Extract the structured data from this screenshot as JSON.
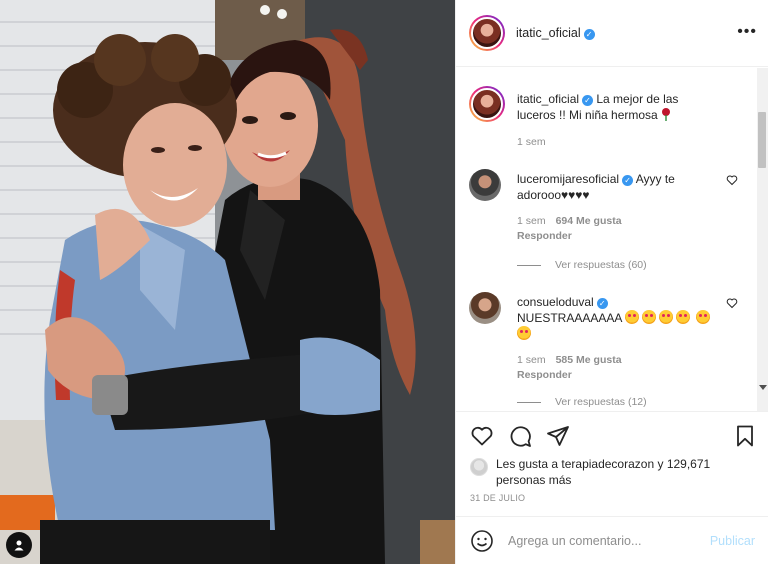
{
  "post": {
    "author": "itatic_oficial",
    "more_label": "•••",
    "photo_alt_icon": "user-tag-icon"
  },
  "caption": {
    "username": "itatic_oficial",
    "text": "La mejor de las luceros !! Mi niña hermosa",
    "time": "1 sem"
  },
  "comments": [
    {
      "username": "luceromijaresoficial",
      "text": "Ayyy te adorooo♥♥♥♥",
      "time": "1 sem",
      "likes": "694 Me gusta",
      "reply": "Responder",
      "view_replies": "Ver respuestas (60)"
    },
    {
      "username": "consueloduval",
      "text": "NUESTRAAAAAAA",
      "time": "1 sem",
      "likes": "585 Me gusta",
      "reply": "Responder",
      "view_replies": "Ver respuestas (12)"
    }
  ],
  "likes": {
    "prefix": "Les gusta a",
    "user": "terapiadecorazon",
    "suffix": "y",
    "others": "129,671 personas más"
  },
  "date": "31 DE JULIO",
  "add_comment": {
    "placeholder": "Agrega un comentario...",
    "publish": "Publicar"
  },
  "colors": {
    "verified": "#3897f0",
    "publish_disabled": "#b2dffc",
    "secondary_text": "#8e8e8e"
  }
}
